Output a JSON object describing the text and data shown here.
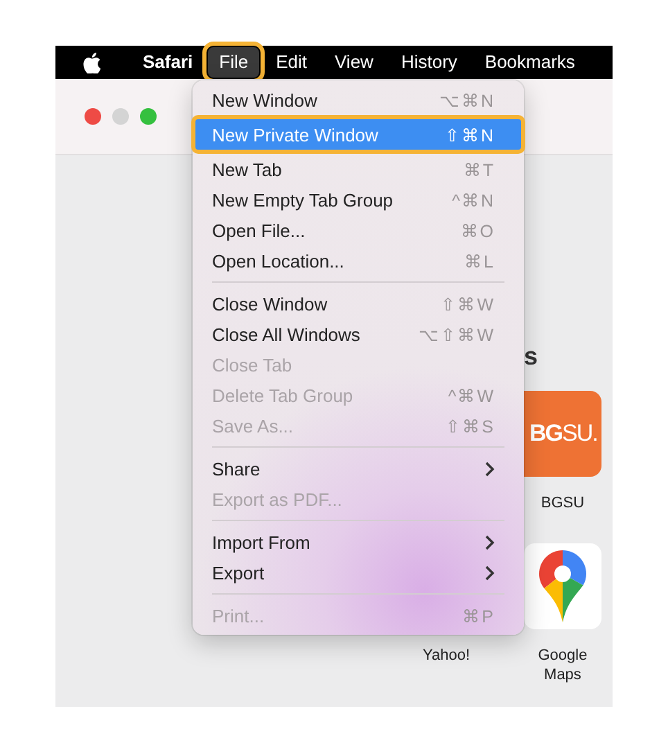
{
  "menu_bar": {
    "items": [
      {
        "label": "Safari",
        "kind": "app",
        "selected": false,
        "callout": false
      },
      {
        "label": "File",
        "kind": "menu",
        "selected": true,
        "callout": true
      },
      {
        "label": "Edit",
        "kind": "menu",
        "selected": false,
        "callout": false
      },
      {
        "label": "View",
        "kind": "menu",
        "selected": false,
        "callout": false
      },
      {
        "label": "History",
        "kind": "menu",
        "selected": false,
        "callout": false
      },
      {
        "label": "Bookmarks",
        "kind": "menu",
        "selected": false,
        "callout": false
      }
    ]
  },
  "content": {
    "heading": "s",
    "tiles": [
      {
        "label": "Yahoo!",
        "kind": "hidden"
      },
      {
        "label": "BGSU",
        "kind": "bgsu",
        "logo_text": "**BG**SU."
      },
      {
        "label": "Google\nMaps",
        "kind": "maps"
      }
    ]
  },
  "file_menu": {
    "groups": [
      [
        {
          "label": "New Window",
          "shortcut": "⌥⌘N",
          "disabled": false,
          "selected": false,
          "callout": false,
          "submenu": false
        },
        {
          "label": "New Private Window",
          "shortcut": "⇧⌘N",
          "disabled": false,
          "selected": true,
          "callout": true,
          "submenu": false
        },
        {
          "label": "New Tab",
          "shortcut": "⌘T",
          "disabled": false,
          "selected": false,
          "callout": false,
          "submenu": false
        },
        {
          "label": "New Empty Tab Group",
          "shortcut": "^⌘N",
          "disabled": false,
          "selected": false,
          "callout": false,
          "submenu": false
        },
        {
          "label": "Open File...",
          "shortcut": "⌘O",
          "disabled": false,
          "selected": false,
          "callout": false,
          "submenu": false
        },
        {
          "label": "Open Location...",
          "shortcut": "⌘L",
          "disabled": false,
          "selected": false,
          "callout": false,
          "submenu": false
        }
      ],
      [
        {
          "label": "Close Window",
          "shortcut": "⇧⌘W",
          "disabled": false,
          "selected": false,
          "callout": false,
          "submenu": false
        },
        {
          "label": "Close All Windows",
          "shortcut": "⌥⇧⌘W",
          "disabled": false,
          "selected": false,
          "callout": false,
          "submenu": false
        },
        {
          "label": "Close Tab",
          "disabled": true,
          "selected": false,
          "callout": false,
          "submenu": false
        },
        {
          "label": "Delete Tab Group",
          "shortcut": "^⌘W",
          "disabled": true,
          "selected": false,
          "callout": false,
          "submenu": false
        },
        {
          "label": "Save As...",
          "shortcut": "⇧⌘S",
          "disabled": true,
          "selected": false,
          "callout": false,
          "submenu": false
        }
      ],
      [
        {
          "label": "Share",
          "disabled": false,
          "selected": false,
          "callout": false,
          "submenu": true
        },
        {
          "label": "Export as PDF...",
          "disabled": true,
          "selected": false,
          "callout": false,
          "submenu": false
        }
      ],
      [
        {
          "label": "Import From",
          "disabled": false,
          "selected": false,
          "callout": false,
          "submenu": true
        },
        {
          "label": "Export",
          "disabled": false,
          "selected": false,
          "callout": false,
          "submenu": true
        }
      ],
      [
        {
          "label": "Print...",
          "shortcut": "⌘P",
          "disabled": true,
          "selected": false,
          "callout": false,
          "submenu": false
        }
      ]
    ]
  }
}
